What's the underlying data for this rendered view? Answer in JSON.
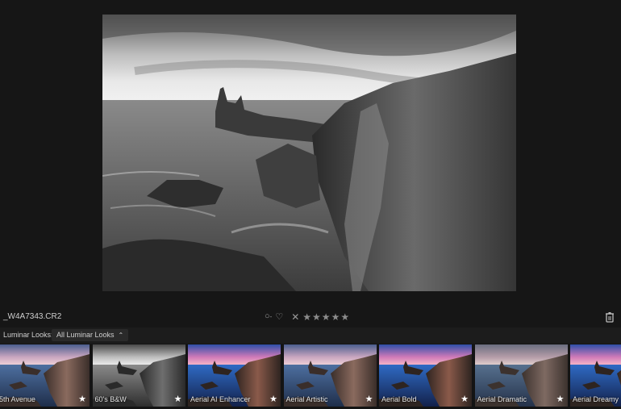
{
  "file": {
    "name": "_W4A7343.CR2"
  },
  "toolbar": {
    "circle_icon": "○",
    "circle_dash": "-",
    "heart_icon": "♡",
    "reject_icon": "✕",
    "stars": [
      "★",
      "★",
      "★",
      "★",
      "★"
    ]
  },
  "looks": {
    "label": "Luminar Looks:",
    "dropdown": "All Luminar Looks",
    "chevron": "⌃"
  },
  "thumbnails": [
    {
      "name": "5th Avenue",
      "style": "color"
    },
    {
      "name": "60's B&W",
      "style": "bw"
    },
    {
      "name": "Aerial AI Enhancer",
      "style": "vivid"
    },
    {
      "name": "Aerial Artistic",
      "style": "color"
    },
    {
      "name": "Aerial Bold",
      "style": "vivid"
    },
    {
      "name": "Aerial Dramatic",
      "style": "muted"
    },
    {
      "name": "Aerial Dreamy",
      "style": "vivid"
    }
  ],
  "star_glyph": "★"
}
